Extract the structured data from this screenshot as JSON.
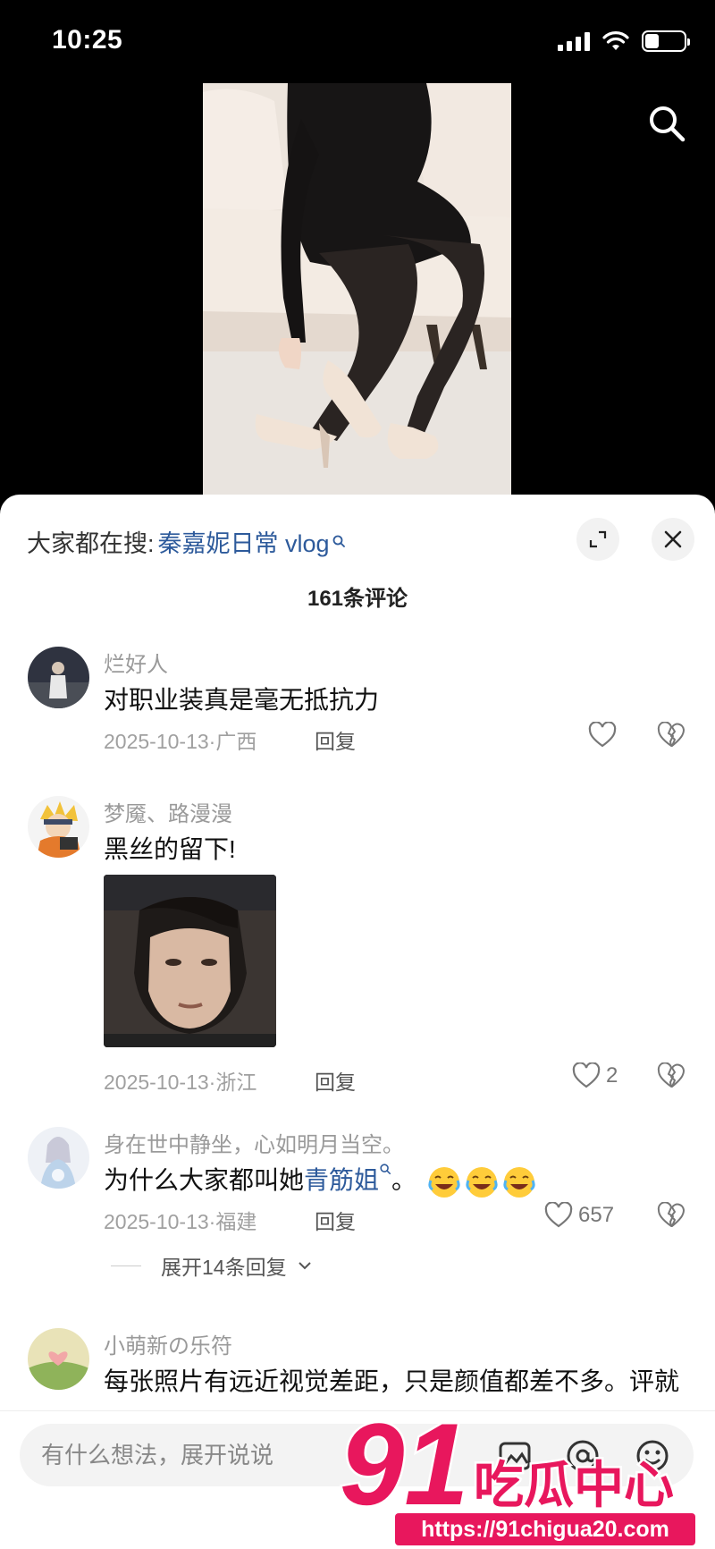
{
  "status_bar": {
    "time": "10:25",
    "battery_level": 0.35
  },
  "video": {
    "search_icon": "search-icon"
  },
  "sheet": {
    "hot_search_label": "大家都在搜:",
    "hot_search_keyword": "秦嘉妮日常 vlog",
    "comment_count": "161条评论"
  },
  "comments": [
    {
      "user": "烂好人",
      "text": "对职业装真是毫无抵抗力",
      "date": "2025-10-13",
      "location": "广西",
      "reply": "回复",
      "likes": ""
    },
    {
      "user": "梦魇、路漫漫",
      "text": "黑丝的留下!",
      "date": "2025-10-13",
      "location": "浙江",
      "reply": "回复",
      "likes": "2"
    },
    {
      "user": "身在世中静坐，心如明月当空。",
      "text_before": "为什么大家都叫她",
      "text_link": "青筋姐",
      "text_after": "。",
      "date": "2025-10-13",
      "location": "福建",
      "reply": "回复",
      "likes": "657",
      "expand": "展开14条回复"
    },
    {
      "user": "小萌新の乐符",
      "text": "每张照片有远近视觉差距，只是颜值都差不多。评就"
    }
  ],
  "input": {
    "placeholder": "有什么想法，展开说说"
  },
  "watermark": {
    "number": "91",
    "brand": "吃瓜中心",
    "url": "https://91chigua20.com"
  },
  "colors": {
    "link": "#2d5a9b",
    "watermark": "#e8175d"
  }
}
